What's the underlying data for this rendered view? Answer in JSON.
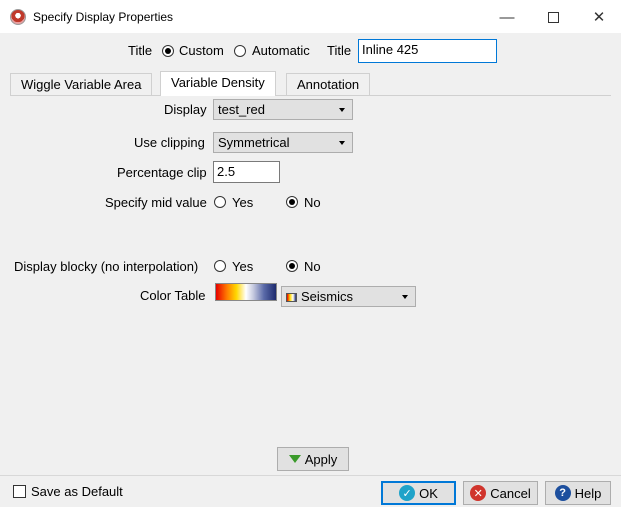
{
  "window": {
    "title": "Specify Display Properties",
    "minimize_glyph": "—",
    "close_glyph": "✕"
  },
  "title_row": {
    "label": "Title",
    "option_custom": "Custom",
    "option_automatic": "Automatic",
    "selected": "Custom",
    "field_label": "Title",
    "field_value": "Inline 425"
  },
  "tabs": [
    {
      "label": "Wiggle Variable Area",
      "active": false
    },
    {
      "label": "Variable Density",
      "active": true
    },
    {
      "label": "Annotation",
      "active": false
    }
  ],
  "form": {
    "display_label": "Display",
    "display_value": "test_red",
    "clipping_label": "Use clipping",
    "clipping_value": "Symmetrical",
    "pct_clip_label": "Percentage clip",
    "pct_clip_value": "2.5",
    "mid_value_label": "Specify mid value",
    "mid_value_yes": "Yes",
    "mid_value_no": "No",
    "mid_value_selected": "No",
    "blocky_label": "Display blocky (no interpolation)",
    "blocky_yes": "Yes",
    "blocky_no": "No",
    "blocky_selected": "No",
    "color_table_label": "Color Table",
    "color_table_value": "Seismics"
  },
  "apply_button": "Apply",
  "footer": {
    "save_default_label": "Save as Default",
    "save_default_checked": false,
    "ok_label": "OK",
    "cancel_label": "Cancel",
    "help_label": "Help"
  },
  "colors": {
    "accent": "#0078d7",
    "ok_icon": "#1fa3c9",
    "cancel_icon": "#d0342c",
    "help_icon": "#1d4f9e",
    "apply_icon": "#3a9a2a"
  }
}
